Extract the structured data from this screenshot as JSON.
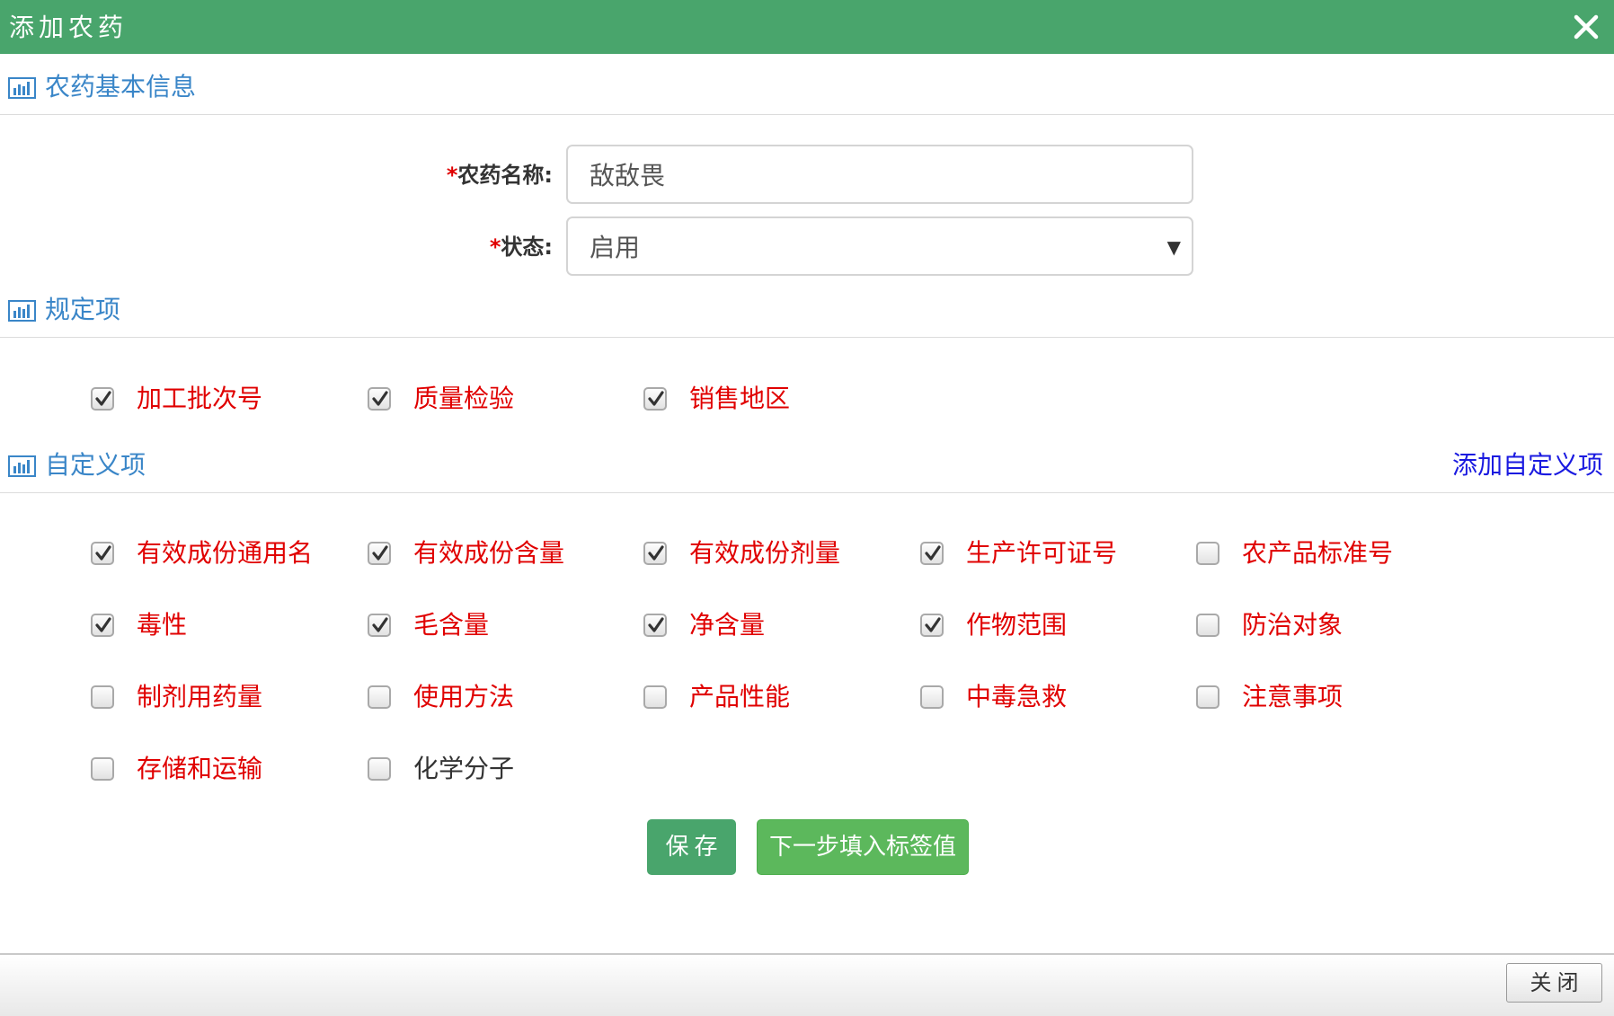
{
  "modal": {
    "title": "添加农药",
    "close_icon": "close-icon"
  },
  "colors": {
    "header": "#49a56c",
    "section_title": "#3a86c8",
    "label_red": "#e00000",
    "link": "#1a1ae0",
    "next_button": "#5cb85c"
  },
  "sections": {
    "basic": {
      "title": "农药基本信息",
      "icon": "bar-chart-icon"
    },
    "required": {
      "title": "规定项",
      "icon": "bar-chart-icon"
    },
    "custom": {
      "title": "自定义项",
      "icon": "bar-chart-icon",
      "add_link": "添加自定义项"
    }
  },
  "form": {
    "required_mark": "*",
    "name_label": "农药名称:",
    "name_value": "敌敌畏",
    "status_label": "状态:",
    "status_value": "启用"
  },
  "required_items": [
    {
      "label": "加工批次号",
      "checked": true
    },
    {
      "label": "质量检验",
      "checked": true
    },
    {
      "label": "销售地区",
      "checked": true
    }
  ],
  "custom_items": [
    {
      "label": "有效成份通用名",
      "checked": true,
      "color": "red"
    },
    {
      "label": "有效成份含量",
      "checked": true,
      "color": "red"
    },
    {
      "label": "有效成份剂量",
      "checked": true,
      "color": "red"
    },
    {
      "label": "生产许可证号",
      "checked": true,
      "color": "red"
    },
    {
      "label": "农产品标准号",
      "checked": false,
      "color": "red"
    },
    {
      "label": "毒性",
      "checked": true,
      "color": "red"
    },
    {
      "label": "毛含量",
      "checked": true,
      "color": "red"
    },
    {
      "label": "净含量",
      "checked": true,
      "color": "red"
    },
    {
      "label": "作物范围",
      "checked": true,
      "color": "red"
    },
    {
      "label": "防治对象",
      "checked": false,
      "color": "red"
    },
    {
      "label": "制剂用药量",
      "checked": false,
      "color": "red"
    },
    {
      "label": "使用方法",
      "checked": false,
      "color": "red"
    },
    {
      "label": "产品性能",
      "checked": false,
      "color": "red"
    },
    {
      "label": "中毒急救",
      "checked": false,
      "color": "red"
    },
    {
      "label": "注意事项",
      "checked": false,
      "color": "red"
    },
    {
      "label": "存储和运输",
      "checked": false,
      "color": "red"
    },
    {
      "label": "化学分子",
      "checked": false,
      "color": "dark"
    }
  ],
  "buttons": {
    "save": "保存",
    "next": "下一步填入标签值",
    "close": "关闭"
  }
}
